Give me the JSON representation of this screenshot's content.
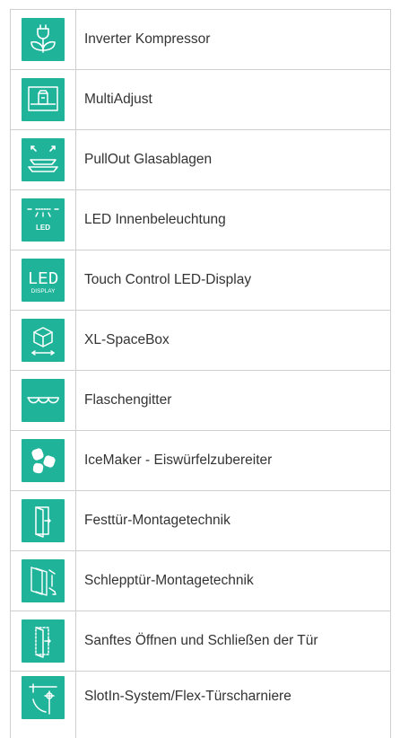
{
  "theme": {
    "accent": "#1fb49a",
    "border": "#cfcfcf",
    "text": "#333333"
  },
  "features": [
    {
      "icon": "plug-leaf-icon",
      "label": "Inverter Kompressor"
    },
    {
      "icon": "multiadjust-icon",
      "label": "MultiAdjust"
    },
    {
      "icon": "pullout-shelf-icon",
      "label": "PullOut Glasablagen"
    },
    {
      "icon": "led-light-icon",
      "label": "LED Innenbeleuchtung",
      "icon_text": "LED"
    },
    {
      "icon": "led-display-icon",
      "label": "Touch Control LED-Display",
      "icon_text": "LED",
      "icon_subtext": "DISPLAY"
    },
    {
      "icon": "spacebox-icon",
      "label": "XL-SpaceBox"
    },
    {
      "icon": "bottle-rack-icon",
      "label": "Flaschengitter"
    },
    {
      "icon": "ice-cubes-icon",
      "label": "IceMaker - Eiswürfelzubereiter"
    },
    {
      "icon": "fixed-door-icon",
      "label": "Festtür-Montagetechnik"
    },
    {
      "icon": "sliding-door-icon",
      "label": "Schlepptür-Montagetechnik"
    },
    {
      "icon": "soft-close-door-icon",
      "label": "Sanftes Öffnen und Schließen der Tür"
    },
    {
      "icon": "door-hinge-icon",
      "label": "SlotIn-System/Flex-Türscharniere"
    }
  ]
}
